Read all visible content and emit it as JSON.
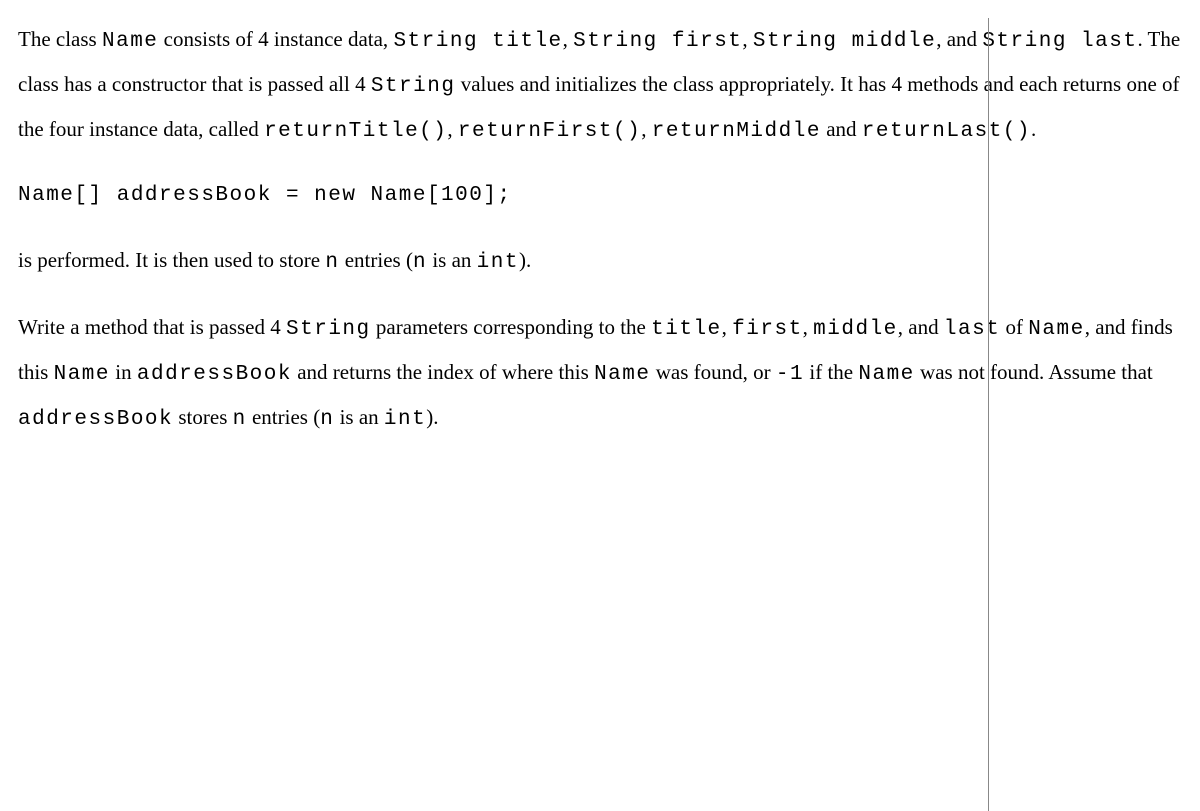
{
  "document": {
    "p1": {
      "t1": "The class ",
      "c1": "Name",
      "t2": " consists of 4 instance data, ",
      "c2": "String title",
      "t3": ", ",
      "c3": "String first",
      "t4": ", ",
      "c4": "String middle",
      "t5": ", and ",
      "c5": "String last",
      "t6": ". The class has a constructor that is passed all 4 ",
      "c6": "String",
      "t7": " values and initializes the class appropriately. It has 4 methods and each returns one of the four instance data, called ",
      "c7": "returnTitle()",
      "t8": ", ",
      "c8": "returnFirst()",
      "t9": ", ",
      "c9": "returnMiddle",
      "t10": " and ",
      "c10": "returnLast()",
      "t11": "."
    },
    "codeblock": "Name[] addressBook = new Name[100];",
    "p2": {
      "t1": "is performed. It is then used to store ",
      "c1": "n",
      "t2": " entries (",
      "c2": "n",
      "t3": " is an ",
      "c3": "int",
      "t4": ")."
    },
    "p3": {
      "t1": "Write a method that is passed 4 ",
      "c1": "String",
      "t2": " parameters corresponding to the ",
      "c2": "title",
      "t3": ", ",
      "c3": "first",
      "t4": ", ",
      "c4": "middle",
      "t5": ", and ",
      "c5": "last",
      "t6": " of ",
      "c6": "Name",
      "t7": ", and finds this ",
      "c7": "Name",
      "t8": " in ",
      "c8": "addressBook",
      "t9": " and returns the index of where this ",
      "c9": "Name",
      "t10": " was found, or ",
      "c10": "-1",
      "t11": " if the ",
      "c11": "Name",
      "t12": " was not found. Assume that ",
      "c12": "addressBook",
      "t13": " stores ",
      "c13": "n",
      "t14": " entries (",
      "c14": "n",
      "t15": " is an ",
      "c15": "int",
      "t16": ")."
    }
  }
}
